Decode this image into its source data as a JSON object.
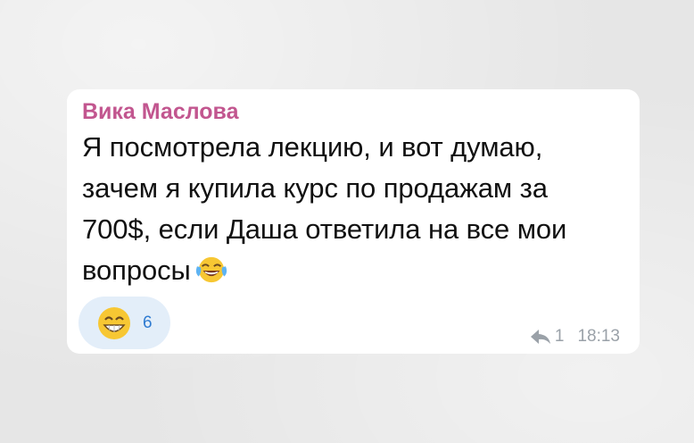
{
  "message": {
    "sender": "Вика Маслова",
    "text": "Я посмотрела лекцию, и вот думаю,\nзачем я купила курс по продажам за\n700$, если Даша ответила на все мои\nвопросы",
    "inline_emoji": "face-with-tears-of-joy-icon",
    "reaction": {
      "emoji": "grinning-face-with-smiling-eyes-icon",
      "count": "6"
    },
    "replies": "1",
    "time": "18:13"
  },
  "colors": {
    "sender": "#c2568f",
    "reaction_bg": "#e3eef9",
    "reaction_count": "#2f7bd1",
    "meta": "#9aa1a8"
  }
}
